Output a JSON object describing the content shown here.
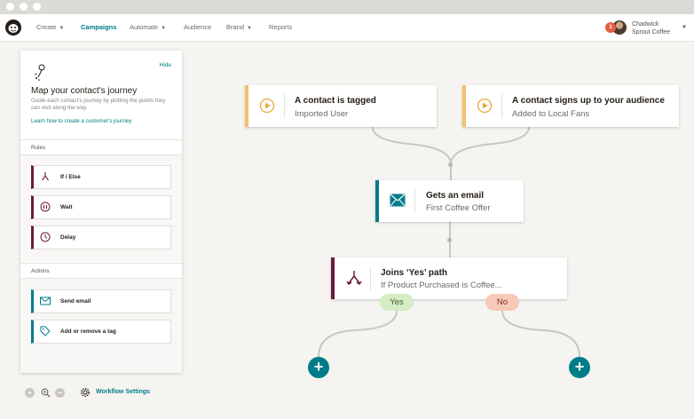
{
  "nav": {
    "items": [
      {
        "label": "Create",
        "has_caret": true
      },
      {
        "label": "Campaigns",
        "active": true
      },
      {
        "label": "Automate",
        "has_caret": true
      },
      {
        "label": "Audience"
      },
      {
        "label": "Brand",
        "has_caret": true
      },
      {
        "label": "Reports"
      }
    ],
    "account": {
      "badge": "1",
      "name_line1": "Chadwick",
      "name_line2": "Sprout Coffee"
    }
  },
  "panel": {
    "hide_label": "Hide",
    "title": "Map your contact's journey",
    "description": "Guide each contact's journey by plotting the points they can visit along the way.",
    "link": "Learn how to create a customer's journey",
    "rules_heading": "Rules",
    "rules": [
      {
        "label": "If / Else",
        "icon": "split-icon"
      },
      {
        "label": "Wait",
        "icon": "pause-icon"
      },
      {
        "label": "Delay",
        "icon": "clock-icon"
      }
    ],
    "actions_heading": "Actions",
    "actions": [
      {
        "label": "Send email",
        "icon": "envelope-icon"
      },
      {
        "label": "Add or remove a tag",
        "icon": "tag-icon"
      }
    ]
  },
  "footer": {
    "zoom_in": "+",
    "zoom_out": "−",
    "workflow_settings": "Workflow Settings"
  },
  "flow": {
    "starting_points": [
      {
        "title": "A contact is tagged",
        "subtitle": "Imported User",
        "icon": "play-icon"
      },
      {
        "title": "A contact signs up to your audience",
        "subtitle": "Added to Local Fans",
        "icon": "play-icon"
      }
    ],
    "email_step": {
      "title": "Gets an  email",
      "subtitle": "First Coffee Offer",
      "icon": "envelope-icon"
    },
    "branch_step": {
      "title": "Joins ‘Yes’ path",
      "subtitle": "If Product Purchased is Coffee...",
      "icon": "split-icon"
    },
    "yes_label": "Yes",
    "no_label": "No",
    "add_label": "+"
  },
  "colors": {
    "teal": "#007c89",
    "plum": "#6b1b3a",
    "amber": "#f2c16c",
    "yes_bg": "#d5ecc4",
    "no_bg": "#f7c9b8"
  }
}
